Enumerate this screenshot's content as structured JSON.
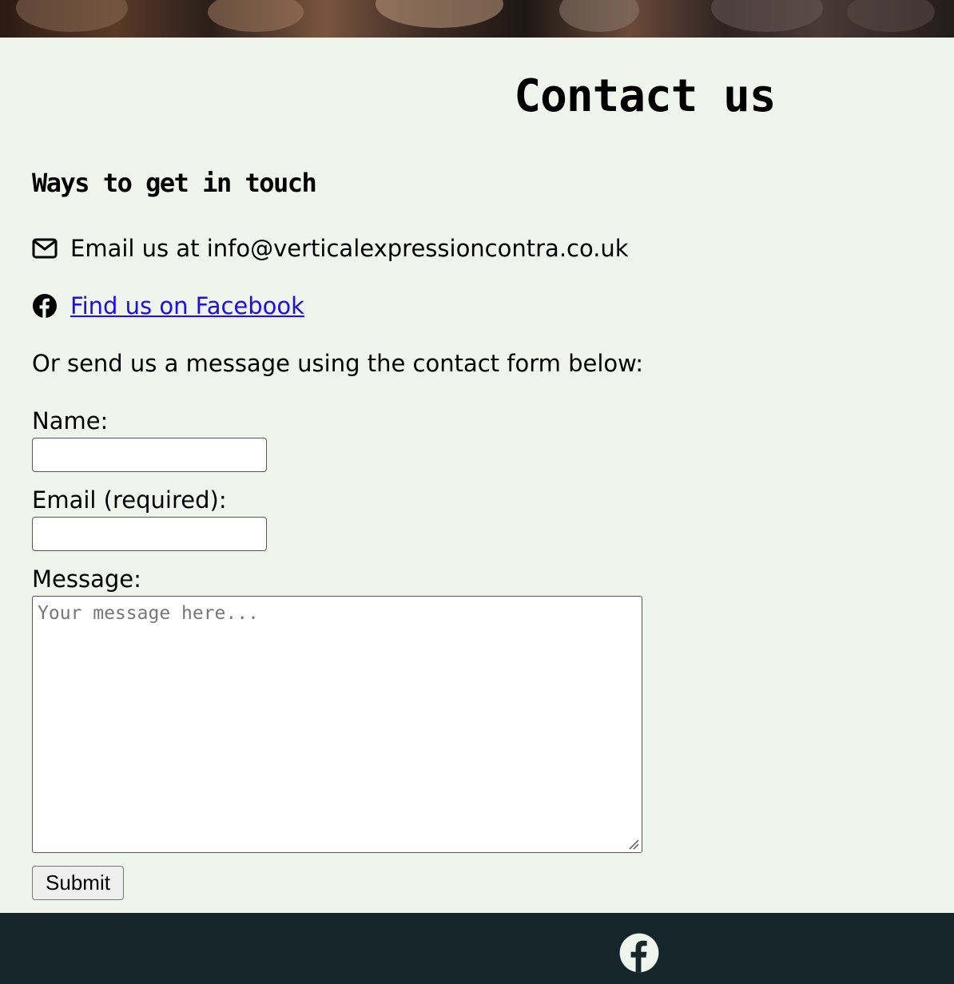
{
  "page": {
    "title": "Contact us",
    "subtitle": "Ways to get in touch"
  },
  "contact": {
    "email_text": "Email us at info@verticalexpressioncontra.co.uk",
    "email_icon": "envelope-icon",
    "facebook_link": "Find us on Facebook",
    "facebook_icon": "facebook-icon",
    "form_intro": "Or send us a message using the contact form below:"
  },
  "form": {
    "name_label": "Name:",
    "name_value": "",
    "email_label": "Email (required):",
    "email_value": "",
    "message_label": "Message:",
    "message_placeholder": "Your message here...",
    "submit_label": "Submit"
  },
  "footer": {
    "icon": "facebook-icon"
  },
  "colors": {
    "page_background": "#eff4ed",
    "footer_background": "#16252a",
    "link": "#1a0dee"
  }
}
